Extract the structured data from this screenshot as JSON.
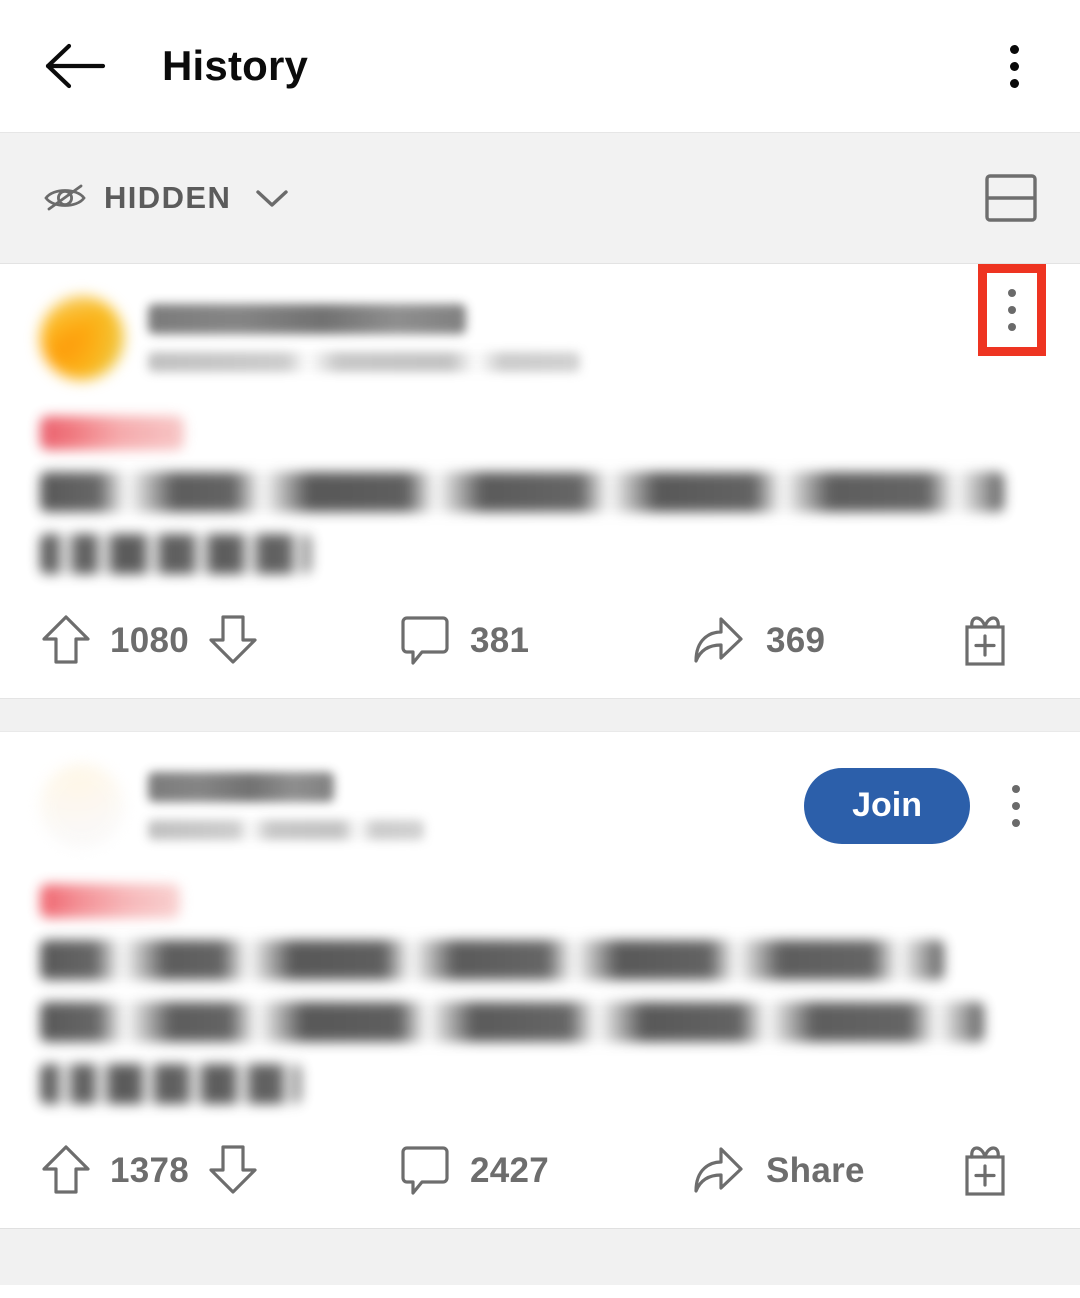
{
  "app": {
    "header": {
      "title": "History",
      "back_icon": "arrow-left-icon",
      "overflow_icon": "kebab-menu-icon"
    },
    "filter_bar": {
      "label": "HIDDEN",
      "eye_off_icon": "eye-off-icon",
      "chevron_icon": "chevron-down-icon",
      "layout_toggle_icon": "card-layout-icon"
    },
    "colors": {
      "highlight": "#EE3421",
      "join_button": "#2C5FAA",
      "filter_bar_bg": "#F2F2F2",
      "separator": "#F1F1F1",
      "action_text": "#6D6D6D",
      "title_text": "#0B0B0B"
    }
  },
  "posts": [
    {
      "subreddit": "",
      "meta": "",
      "flair": "",
      "title": "",
      "upvotes": "1080",
      "comments": "381",
      "share": "369",
      "has_join_button": false,
      "join_label": "",
      "is_highlighted": true,
      "icons": {
        "upvote": "upvote-arrow-icon",
        "downvote": "downvote-arrow-icon",
        "comment": "comment-bubble-icon",
        "share": "share-arrow-icon",
        "award": "award-gift-icon",
        "overflow": "kebab-menu-icon"
      }
    },
    {
      "subreddit": "",
      "meta": "",
      "flair": "",
      "title": "",
      "upvotes": "1378",
      "comments": "2427",
      "share": "Share",
      "has_join_button": true,
      "join_label": "Join",
      "is_highlighted": false,
      "icons": {
        "upvote": "upvote-arrow-icon",
        "downvote": "downvote-arrow-icon",
        "comment": "comment-bubble-icon",
        "share": "share-arrow-icon",
        "award": "award-gift-icon",
        "overflow": "kebab-menu-icon"
      }
    }
  ]
}
